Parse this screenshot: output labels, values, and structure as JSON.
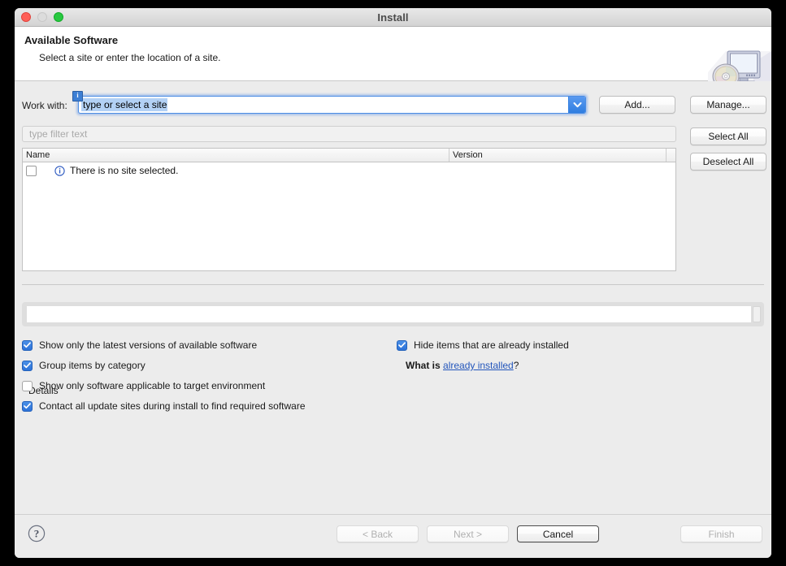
{
  "window": {
    "title": "Install",
    "controls": {
      "close": "close-button",
      "minimize": "minimize-button",
      "zoom": "zoom-button"
    }
  },
  "header": {
    "title": "Available Software",
    "subtitle": "Select a site or enter the location of a site.",
    "banner_icon": "monitor-with-disc-icon"
  },
  "work_with": {
    "label": "Work with:",
    "value": "type or select a site",
    "info_badge": "i",
    "info_badge_name": "content-assist-info-icon",
    "dropdown_icon": "chevron-down-icon",
    "add_label": "Add...",
    "manage_label": "Manage..."
  },
  "filter": {
    "placeholder": "type filter text",
    "value": ""
  },
  "table": {
    "columns": [
      "Name",
      "Version",
      ""
    ],
    "rows": [
      {
        "checked": false,
        "icon": "info-circle-icon",
        "name": "There is no site selected.",
        "version": ""
      }
    ],
    "select_all_label": "Select All",
    "deselect_all_label": "Deselect All"
  },
  "details": {
    "label": "Details",
    "value": ""
  },
  "options": {
    "left": [
      {
        "label": "Show only the latest versions of available software",
        "checked": true
      },
      {
        "label": "Group items by category",
        "checked": true
      },
      {
        "label": "Show only software applicable to target environment",
        "checked": false
      },
      {
        "label": "Contact all update sites during install to find required software",
        "checked": true
      }
    ],
    "right": [
      {
        "label": "Hide items that are already installed",
        "checked": true
      }
    ],
    "whatis": {
      "lead": "What is ",
      "link": "already installed",
      "tail": "?"
    }
  },
  "footer": {
    "help_icon": "question-mark-icon",
    "buttons": [
      {
        "label": "< Back",
        "enabled": false,
        "default": false
      },
      {
        "label": "Next >",
        "enabled": false,
        "default": false
      },
      {
        "label": "Cancel",
        "enabled": true,
        "default": true
      },
      {
        "label": "Finish",
        "enabled": false,
        "default": false
      }
    ]
  },
  "colors": {
    "accent": "#2d72d8",
    "link": "#2255bb",
    "window_bg": "#ececec",
    "header_bg": "#ffffff",
    "close": "#ff5f57",
    "minimize": "#dcdcdc",
    "zoom": "#28c840"
  }
}
